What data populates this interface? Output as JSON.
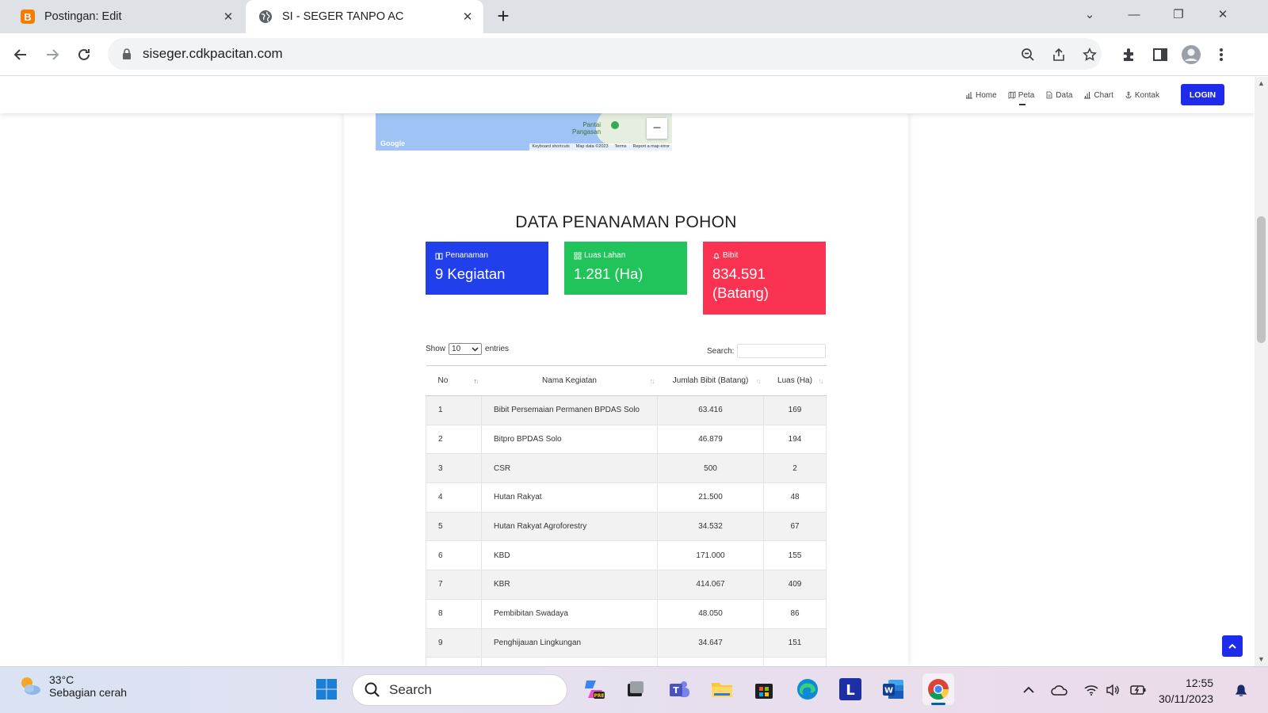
{
  "browser": {
    "tabs": [
      {
        "title": "Postingan: Edit",
        "icon": "blogger-icon",
        "active": false
      },
      {
        "title": "SI - SEGER TANPO AC",
        "icon": "globe-icon",
        "active": true
      }
    ],
    "new_tab_label": "+",
    "url": "siseger.cdkpacitan.com"
  },
  "site": {
    "menu": [
      {
        "label": "Home",
        "icon": "chart-icon"
      },
      {
        "label": "Peta",
        "icon": "map-icon"
      },
      {
        "label": "Data",
        "icon": "document-icon"
      },
      {
        "label": "Chart",
        "icon": "bar-chart-icon"
      },
      {
        "label": "Kontak",
        "icon": "anchor-icon"
      }
    ],
    "login_label": "LOGIN",
    "accent": "#1f2bea"
  },
  "map": {
    "provider": "Google",
    "place_label_1": "Pantai",
    "place_label_2": "Pangasan",
    "zoom_out": "−",
    "attribution": [
      "Keyboard shortcuts",
      "Map data ©2023",
      "Terms",
      "Report a map error"
    ]
  },
  "section_title": "DATA PENANAMAN POHON",
  "stats": [
    {
      "label": "Penanaman",
      "value": "9 Kegiatan",
      "color": "#2140ec",
      "icon": "book-icon"
    },
    {
      "label": "Luas Lahan",
      "value": "1.281 (Ha)",
      "color": "#21c45a",
      "icon": "grid-icon"
    },
    {
      "label": "Bibit",
      "value": "834.591 (Batang)",
      "color": "#fb3353",
      "icon": "bell-icon"
    }
  ],
  "table_controls": {
    "show_label": "Show",
    "page_length": "10",
    "entries_label": "entries",
    "search_label": "Search:"
  },
  "table": {
    "headers": [
      "No",
      "Nama Kegiatan",
      "Jumlah Bibit (Batang)",
      "Luas (Ha)"
    ],
    "rows": [
      [
        "1",
        "Bibit Persemaian Permanen BPDAS Solo",
        "63.416",
        "169"
      ],
      [
        "2",
        "Bitpro BPDAS Solo",
        "46.879",
        "194"
      ],
      [
        "3",
        "CSR",
        "500",
        "2"
      ],
      [
        "4",
        "Hutan Rakyat",
        "21.500",
        "48"
      ],
      [
        "5",
        "Hutan Rakyat Agroforestry",
        "34.532",
        "67"
      ],
      [
        "6",
        "KBD",
        "171.000",
        "155"
      ],
      [
        "7",
        "KBR",
        "414.067",
        "409"
      ],
      [
        "8",
        "Pembibitan Swadaya",
        "48.050",
        "86"
      ],
      [
        "9",
        "Penghijauan Lingkungan",
        "34.647",
        "151"
      ]
    ]
  },
  "taskbar": {
    "temperature": "33°C",
    "condition": "Sebagian cerah",
    "search_placeholder": "Search",
    "time": "12:55",
    "date": "30/11/2023"
  }
}
